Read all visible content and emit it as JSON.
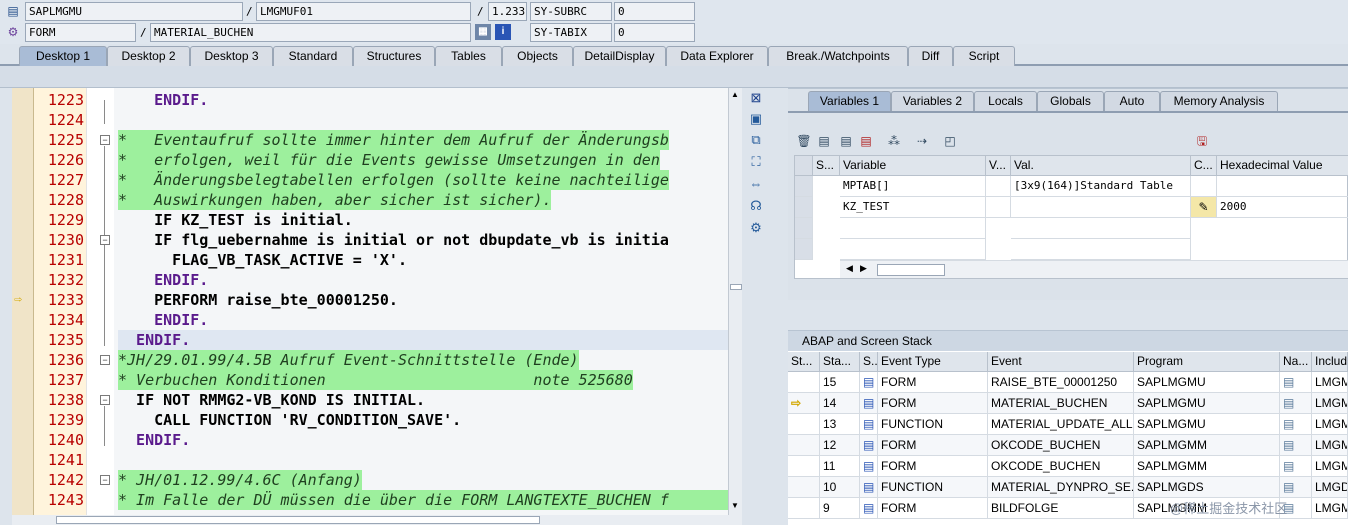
{
  "header": {
    "row1": {
      "program": "SAPLMGMU",
      "include": "LMGMUF01",
      "line": "1.233",
      "sysfield": "SY-SUBRC",
      "sysvalue": "0"
    },
    "row2": {
      "event_type": "FORM",
      "event": "MATERIAL_BUCHEN",
      "sysfield": "SY-TABIX",
      "sysvalue": "0"
    },
    "separator": "/"
  },
  "tabs": [
    "Desktop 1",
    "Desktop 2",
    "Desktop 3",
    "Standard",
    "Structures",
    "Tables",
    "Objects",
    "DetailDisplay",
    "Data Explorer",
    "Break./Watchpoints",
    "Diff",
    "Script"
  ],
  "code": {
    "lines": [
      {
        "no": "1223",
        "type": "code",
        "html": "    ENDIF."
      },
      {
        "no": "1224",
        "type": "code",
        "html": ""
      },
      {
        "no": "1225",
        "type": "comment",
        "html": "*   Eventaufruf sollte immer hinter dem Aufruf der Änderungsb"
      },
      {
        "no": "1226",
        "type": "comment",
        "html": "*   erfolgen, weil für die Events gewisse Umsetzungen in den"
      },
      {
        "no": "1227",
        "type": "comment",
        "html": "*   Änderungsbelegtabellen erfolgen (sollte keine nachteilige"
      },
      {
        "no": "1228",
        "type": "comment",
        "html": "*   Auswirkungen haben, aber sicher ist sicher)."
      },
      {
        "no": "1229",
        "type": "code",
        "html": "    IF KZ_TEST is initial."
      },
      {
        "no": "1230",
        "type": "code",
        "html": "    IF flg_uebernahme is initial or not dbupdate_vb is initia"
      },
      {
        "no": "1231",
        "type": "code",
        "html": "      FLAG_VB_TASK_ACTIVE = 'X'."
      },
      {
        "no": "1232",
        "type": "code",
        "html": "    ENDIF."
      },
      {
        "no": "1233",
        "type": "code",
        "html": "    PERFORM raise_bte_00001250."
      },
      {
        "no": "1234",
        "type": "code",
        "html": "    ENDIF."
      },
      {
        "no": "1235",
        "type": "code",
        "html": "  ENDIF."
      },
      {
        "no": "1236",
        "type": "comment",
        "html": "*JH/29.01.99/4.5B Aufruf Event-Schnittstelle (Ende)"
      },
      {
        "no": "1237",
        "type": "comment",
        "html": "* Verbuchen Konditionen                       note 525680"
      },
      {
        "no": "1238",
        "type": "code",
        "html": "  IF NOT RMMG2-VB_KOND IS INITIAL."
      },
      {
        "no": "1239",
        "type": "code",
        "html": "    CALL FUNCTION 'RV_CONDITION_SAVE'."
      },
      {
        "no": "1240",
        "type": "code",
        "html": "  ENDIF."
      },
      {
        "no": "1241",
        "type": "code",
        "html": ""
      },
      {
        "no": "1242",
        "type": "comment",
        "html": "* JH/01.12.99/4.6C (Anfang)"
      },
      {
        "no": "1243",
        "type": "comment",
        "html": "* Im Falle der DÜ müssen die über die FORM LANGTEXTE_BUCHEN f"
      }
    ]
  },
  "variables": {
    "tabs": [
      "Variables 1",
      "Variables 2",
      "Locals",
      "Globals",
      "Auto",
      "Memory Analysis"
    ],
    "columns": [
      "S...",
      "Variable",
      "V...",
      "Val.",
      "C...",
      "Hexadecimal Value"
    ],
    "rows": [
      {
        "variable": "MPTAB[]",
        "value": "[3x9(164)]Standard Table",
        "hex": ""
      },
      {
        "variable": "KZ_TEST",
        "value": "",
        "hex": "2000"
      }
    ]
  },
  "stack": {
    "title": "ABAP and Screen Stack",
    "columns": [
      "St...",
      "Sta...",
      "S...",
      "Event Type",
      "Event",
      "Program",
      "Na...",
      "Includ"
    ],
    "rows": [
      {
        "level": "15",
        "type": "FORM",
        "event": "RAISE_BTE_00001250",
        "program": "SAPLMGMU",
        "include": "LMGMU",
        "current": false
      },
      {
        "level": "14",
        "type": "FORM",
        "event": "MATERIAL_BUCHEN",
        "program": "SAPLMGMU",
        "include": "LMGMU",
        "current": true
      },
      {
        "level": "13",
        "type": "FUNCTION",
        "event": "MATERIAL_UPDATE_ALL",
        "program": "SAPLMGMU",
        "include": "LMGMU",
        "current": false
      },
      {
        "level": "12",
        "type": "FORM",
        "event": "OKCODE_BUCHEN",
        "program": "SAPLMGMM",
        "include": "LMGMM",
        "current": false
      },
      {
        "level": "11",
        "type": "FORM",
        "event": "OKCODE_BUCHEN",
        "program": "SAPLMGMM",
        "include": "LMGMM",
        "current": false
      },
      {
        "level": "10",
        "type": "FUNCTION",
        "event": "MATERIAL_DYNPRO_SE...",
        "program": "SAPLMGDS",
        "include": "LMGDS",
        "current": false
      },
      {
        "level": "9",
        "type": "FORM",
        "event": "BILDFOLGE",
        "program": "SAPLMGMM",
        "include": "LMGMM",
        "current": false
      }
    ]
  },
  "watermark": "@稀土掘金技术社区",
  "colors": {
    "comment_bg": "#9df09d",
    "keyword": "#5a1a8c",
    "line_number": "#b80000",
    "active_tab": "#a9bcd6"
  }
}
